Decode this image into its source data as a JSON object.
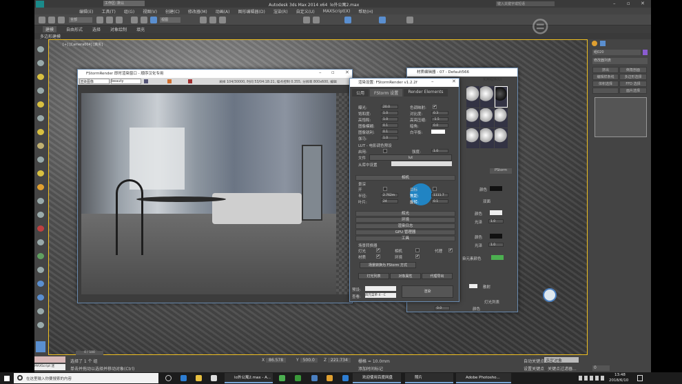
{
  "app": {
    "title": "Autodesk 3ds Max 2014 x64",
    "file": "lo外公寓2.max",
    "workspace": "工作区: 默认",
    "search_placeholder": "键入关键字或短语"
  },
  "menu": [
    "编辑(E)",
    "工具(T)",
    "组(G)",
    "视图(V)",
    "创建(C)",
    "修改器(M)",
    "动画(A)",
    "图形编辑器(D)",
    "渲染(R)",
    "自定义(U)",
    "MAXScript(X)",
    "帮助(H)"
  ],
  "toolbar": {
    "filter": "全部",
    "view": "视图"
  },
  "ribbon": {
    "tabs": [
      "建模",
      "自由形式",
      "选择",
      "对象绘制",
      "填充"
    ],
    "sub": "多边形建模"
  },
  "viewport": {
    "label": "[+] [Camera004] [真实]"
  },
  "command_panel": {
    "name": "组020",
    "color": "#8a5cd0",
    "modifier_list": "修改器列表",
    "buttons": [
      "挤出",
      "倒角剖面",
      "编辑样条线",
      "多边形选择",
      "体积选择",
      "FFD 选择",
      "",
      "面片选择"
    ]
  },
  "framebuffer": {
    "title": "FStormRender 即时渲染窗口 - 顺序汉化专用",
    "channel": "渲染图像",
    "pass": "beauty",
    "stats": "采样 104/30000, 时间 53/04:18:21, 噪点控制 0.355, 分辨率 800x600, 编辑"
  },
  "render_setup": {
    "title": "渲染设置: FStormRender v1.2.2f",
    "tabs": [
      "公用",
      "FStorm 设置",
      "Render Elements"
    ],
    "left": [
      {
        "label": "曝光:",
        "value": "20.0"
      },
      {
        "label": "饱和度:",
        "value": "1.0"
      },
      {
        "label": "高饱和:",
        "value": "1.0"
      },
      {
        "label": "图像模糊:",
        "value": "0.1"
      },
      {
        "label": "图像锐利:",
        "value": "0.1"
      },
      {
        "label": "伽马:",
        "value": "1.0"
      }
    ],
    "right": [
      {
        "label": "色调映射:",
        "value": "✔"
      },
      {
        "label": "对比度:",
        "value": "0.3"
      },
      {
        "label": "高亮压缩:",
        "value": "-1.5"
      },
      {
        "label": "暗角:",
        "value": "0.0"
      },
      {
        "label": "白平衡:",
        "value": ""
      }
    ],
    "lut": {
      "group": "LUT - 电影调色预设",
      "enable": "启用:",
      "strength_label": "强度:",
      "strength": "1.0",
      "file": "文件",
      "file_value": "lut",
      "preset": "从库中设置"
    },
    "camera": {
      "rollout": "相机",
      "group": "景深",
      "on": "开",
      "target": "目标",
      "radius": "半径:",
      "radius_value": "2.762m",
      "focus": "焦距:",
      "focus_value": "1111.7",
      "blades": "叶片:",
      "blades_value": "24",
      "rotation": "旋转:",
      "rotation_value": "0.1"
    },
    "rollouts": [
      "辉光",
      "环境",
      "渲染日志",
      "GPU 管理器",
      "工具"
    ],
    "tools": {
      "group": "场景转换器",
      "items": [
        {
          "label": "灯光",
          "checked": true
        },
        {
          "label": "相机",
          "checked": false
        },
        {
          "label": "代理",
          "checked": true
        },
        {
          "label": "材质",
          "checked": true
        },
        {
          "label": "环境",
          "checked": true
        }
      ],
      "convert": "场景转换为 FStorm 方式",
      "buttons": [
        "灯光列表",
        "对象属性",
        "代理导出"
      ]
    },
    "preset_label": "预设:",
    "view_label": "查看:",
    "view_value": "四元菜单 4 - C",
    "render": "渲染"
  },
  "material_editor": {
    "title": "材质编辑器 - 07 - Default566",
    "menu": "实用程序(U)",
    "renderer": "PStorm",
    "labels": [
      "颜色",
      "双面",
      "颜色",
      "光泽",
      "颜色",
      "光泽",
      "染元素颜色",
      "散射",
      "灯光列表",
      "颜色"
    ],
    "values": [
      "1.0",
      "1.0",
      "0.0"
    ],
    "accent": "#4caf50"
  },
  "status": {
    "selection": "选择了 1 个 组",
    "prompt": "单击并拖动以选择并移动对象(Ctrl)",
    "script": "MAXScript 迷",
    "x": "86.578",
    "y": "500.0",
    "z": "221.734",
    "grid": "栅格 = 10.0mm",
    "auto_key": "自动关键点",
    "selected": "选定对象",
    "set_key": "设置关键点",
    "key_filter": "关键点过滤器...",
    "add_time_tag": "添加时间标记",
    "frame": "0",
    "timeline": "0 / 100"
  },
  "taskbar": {
    "search": "在这里输入你要搜索的内容",
    "apps": [
      "lo外公寓2.max - A...",
      "欢迎使用百度网盘",
      "照片",
      "Adobe Photosho..."
    ],
    "time": "13:48",
    "date": "2018/6/10"
  },
  "watermark": "虎课网"
}
